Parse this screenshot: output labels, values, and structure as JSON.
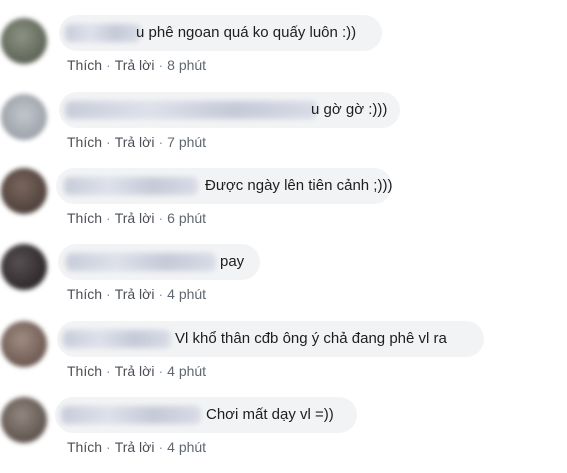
{
  "comments": [
    {
      "text": "u phê ngoan quá ko quấy luôn :))",
      "like": "Thích",
      "reply": "Trả lời",
      "sep": "·",
      "time": "8 phút",
      "avatar_color": "#6f7567"
    },
    {
      "text": "u gờ gờ :)))",
      "like": "Thích",
      "reply": "Trả lời",
      "sep": "·",
      "time": "7 phút",
      "avatar_color": "#a9aeb6"
    },
    {
      "text": "Được ngày lên tiên cảnh ;)))",
      "like": "Thích",
      "reply": "Trả lời",
      "sep": "·",
      "time": "6 phút",
      "avatar_color": "#5a4a44"
    },
    {
      "text": "pay",
      "like": "Thích",
      "reply": "Trả lời",
      "sep": "·",
      "time": "4 phút",
      "avatar_color": "#3a3436"
    },
    {
      "text": "Vl khổ thân cđb ông ý chả đang phê vl ra",
      "like": "Thích",
      "reply": "Trả lời",
      "sep": "·",
      "time": "4 phút",
      "avatar_color": "#826e66"
    },
    {
      "text": "Chơi mất dạy vl =))",
      "like": "Thích",
      "reply": "Trả lời",
      "sep": "·",
      "time": "4 phút",
      "avatar_color": "#756a63"
    }
  ]
}
